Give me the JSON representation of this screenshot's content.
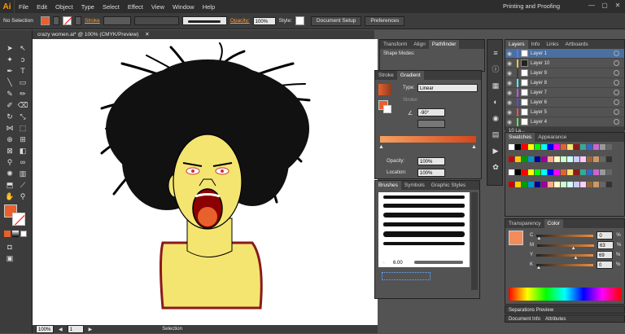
{
  "app": {
    "logo": "Ai",
    "menus": [
      "File",
      "Edit",
      "Object",
      "Type",
      "Select",
      "Effect",
      "View",
      "Window",
      "Help"
    ],
    "workspace": "Printing and Proofing",
    "win_min": "—",
    "win_max": "▢",
    "win_close": "✕"
  },
  "control": {
    "selection": "No Selection",
    "stroke_label": "Stroke",
    "opacity_label": "Opacity:",
    "opacity_value": "100%",
    "style_label": "Style:",
    "doc_setup": "Document Setup",
    "preferences": "Preferences",
    "fill_color": "#e8602c"
  },
  "document": {
    "tab": "crazy women.ai* @ 100% (CMYK/Preview)",
    "close": "✕"
  },
  "status": {
    "zoom": "100%",
    "page": "1",
    "mode": "Selection"
  },
  "pathfinder_panel": {
    "tabs": [
      "Transform",
      "Align",
      "Pathfinder"
    ],
    "shape_modes": "Shape Modes:"
  },
  "gradient_panel": {
    "tabs": [
      "Stroke",
      "Gradient"
    ],
    "type_label": "Type:",
    "type_value": "Linear",
    "stroke_label": "Stroke:",
    "angle": "-90°",
    "opacity_label": "Opacity:",
    "opacity_value": "100%",
    "location_label": "Location:",
    "location_value": "100%"
  },
  "brushes_panel": {
    "tabs": [
      "Brushes",
      "Symbols",
      "Graphic Styles"
    ],
    "size": "6.00"
  },
  "layers_panel": {
    "tabs": [
      "Layers",
      "Info",
      "Links",
      "Artboards"
    ],
    "count": "10 La...",
    "layers": [
      {
        "name": "Layer 1",
        "color": "#4f7df0"
      },
      {
        "name": "Layer 10",
        "color": "#f0c24f"
      },
      {
        "name": "Layer 9",
        "color": "#3c3c3c"
      },
      {
        "name": "Layer 8",
        "color": "#4ff0f0"
      },
      {
        "name": "Layer 7",
        "color": "#c84ff0"
      },
      {
        "name": "Layer 6",
        "color": "#4f4ff0"
      },
      {
        "name": "Layer 5",
        "color": "#f04f4f"
      },
      {
        "name": "Layer 4",
        "color": "#4ff04f"
      }
    ]
  },
  "swatches_panel": {
    "tabs": [
      "Swatches",
      "Appearance"
    ]
  },
  "color_panel": {
    "tabs": [
      "Transparency",
      "Color"
    ],
    "channels": [
      {
        "label": "C",
        "value": "0",
        "fraction": 0
      },
      {
        "label": "M",
        "value": "63",
        "fraction": 0.63
      },
      {
        "label": "Y",
        "value": "69",
        "fraction": 0.69
      },
      {
        "label": "K",
        "value": "0",
        "fraction": 0
      }
    ],
    "pct": "%",
    "color": "#f28c5b"
  },
  "separations": {
    "label": "Separations Preview"
  },
  "document_info": {
    "tabs": [
      "Document Info",
      "Attributes"
    ]
  }
}
